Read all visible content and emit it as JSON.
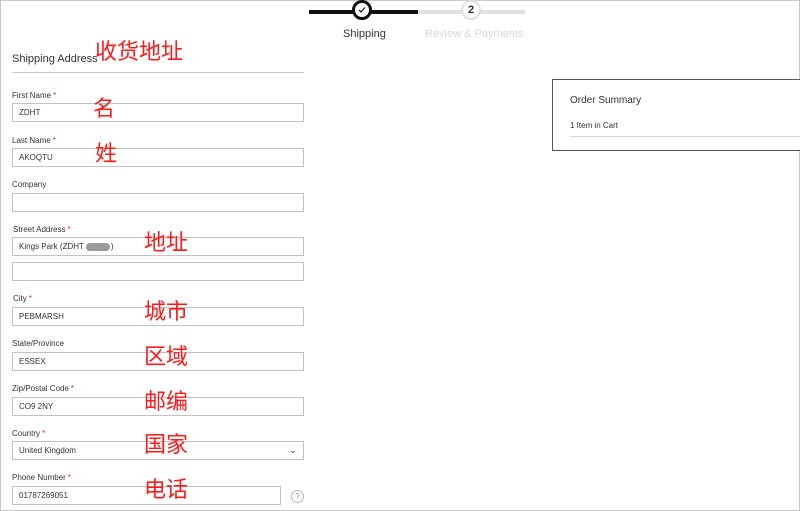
{
  "progress": {
    "step1": {
      "icon": "checkmark-icon",
      "label": "Shipping",
      "status": "completed"
    },
    "step2": {
      "number": "2",
      "label": "Review & Payments",
      "status": "pending"
    }
  },
  "form": {
    "title": "Shipping Address",
    "fields": {
      "first_name": {
        "label": "First Name",
        "value": "ZDHT",
        "required": true
      },
      "last_name": {
        "label": "Last Name",
        "value": "AKOQTU",
        "required": true
      },
      "company": {
        "label": "Company",
        "value": ""
      },
      "street": {
        "label": "Street Address",
        "value_prefix": "Kings Park (ZDHT",
        "value_suffix": ")",
        "line2": "",
        "required": true
      },
      "city": {
        "label": "City",
        "value": "PEBMARSH",
        "required": true
      },
      "state": {
        "label": "State/Province",
        "value": "ESSEX"
      },
      "zip": {
        "label": "Zip/Postal Code",
        "value": "CO9 2NY",
        "required": true
      },
      "country": {
        "label": "Country",
        "value": "United Kingdom",
        "required": true
      },
      "phone": {
        "label": "Phone Number",
        "value": "01787269051",
        "required": true,
        "help": "?"
      }
    },
    "required_marker": "*"
  },
  "annotations": {
    "shipping_address": "收货地址",
    "first_name": "名",
    "last_name": "姓",
    "street": "地址",
    "city": "城市",
    "state": "区域",
    "zip": "邮编",
    "country": "国家",
    "phone": "电话"
  },
  "summary": {
    "title": "Order Summary",
    "items": "1 Item in Cart"
  },
  "colors": {
    "required": "#e02b27",
    "annotation": "#ff1a1a",
    "progress_done": "#111111",
    "progress_todo": "#e1e1e1"
  }
}
